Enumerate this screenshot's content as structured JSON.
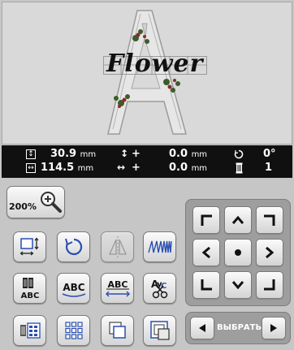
{
  "preview": {
    "embroidery_text": "Flower",
    "letter": "A"
  },
  "status": {
    "height_value": "30.9",
    "height_unit": "mm",
    "width_value": "114.5",
    "width_unit": "mm",
    "vert_offset_sign": "+",
    "vert_offset_value": "0.0",
    "vert_offset_unit": "mm",
    "horiz_offset_sign": "+",
    "horiz_offset_value": "0.0",
    "horiz_offset_unit": "mm",
    "rotation_value": "0°",
    "thread_count_value": "1"
  },
  "zoom": {
    "label": "200%"
  },
  "select": {
    "label": "ВЫБРАТЬ"
  },
  "colors": {
    "background": "#c6c6c6",
    "status_bar": "#101010",
    "pad_panel": "#9e9e9e",
    "button_face": "#eeeeee",
    "icon_blue": "#2a4fb0"
  },
  "icons": {
    "tools_row1": [
      "size-icon",
      "rotate-icon",
      "mirror-icon",
      "density-icon"
    ],
    "tools_row2": [
      "thread-color-icon",
      "arc-text-icon",
      "letter-spacing-icon",
      "split-text-icon"
    ],
    "tools_row3": [
      "color-sort-icon",
      "array-icon",
      "outline-icon",
      "border-icon"
    ],
    "pad": [
      "move-up-left-icon",
      "move-up-icon",
      "move-up-right-icon",
      "move-left-icon",
      "center-icon",
      "move-right-icon",
      "move-down-left-icon",
      "move-down-icon",
      "move-down-right-icon"
    ]
  }
}
